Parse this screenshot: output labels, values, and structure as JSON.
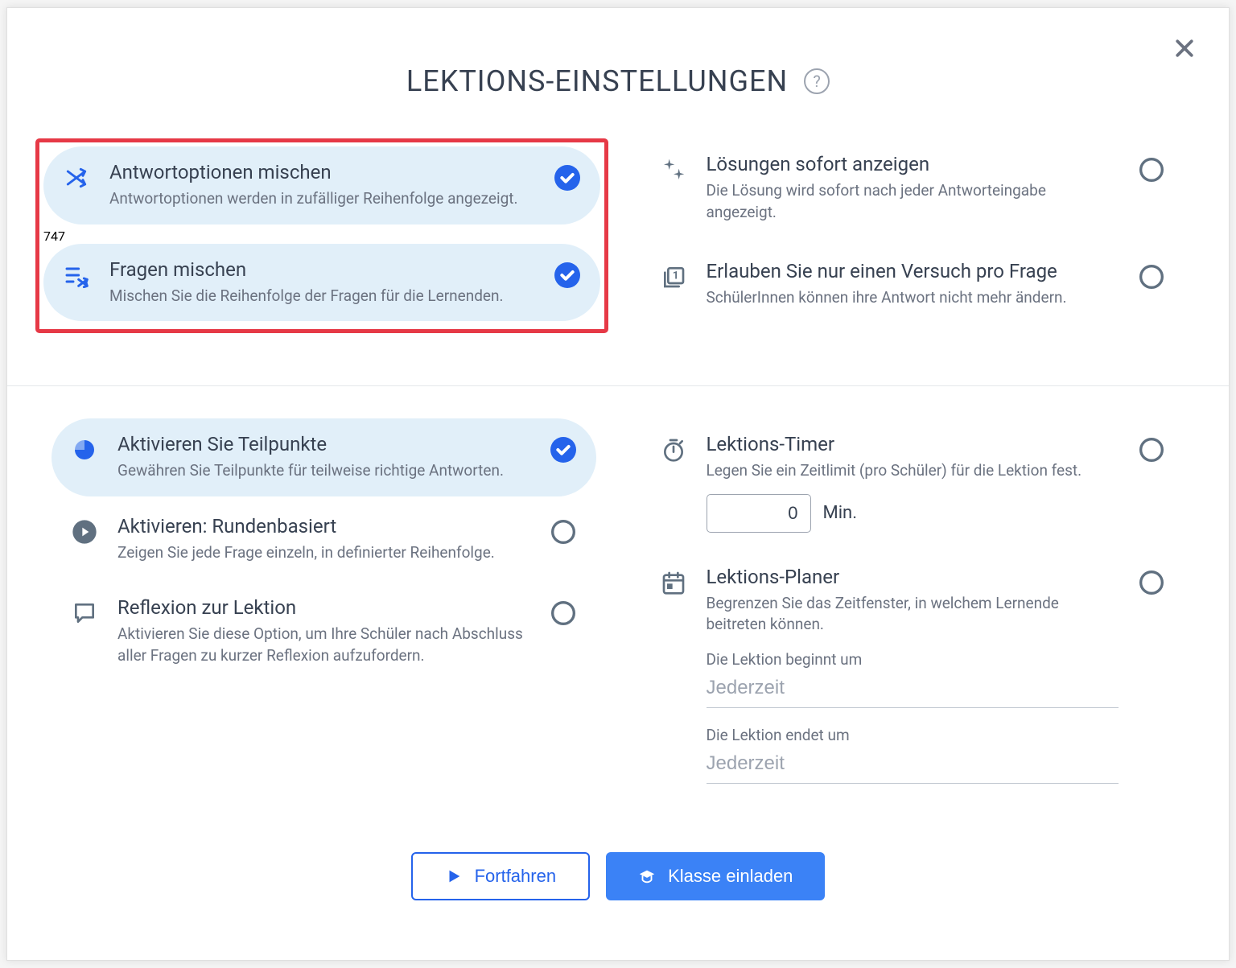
{
  "title": "LEKTIONS-EINSTELLUNGEN",
  "options": {
    "shuffle_answers": {
      "title": "Antwortoptionen mischen",
      "desc": "Antwortoptionen werden in zufälliger Reihenfolge angezeigt.",
      "selected": true
    },
    "shuffle_questions": {
      "title": "Fragen mischen",
      "desc": "Mischen Sie die Reihenfolge der Fragen für die Lernenden.",
      "selected": true
    },
    "show_solutions": {
      "title": "Lösungen sofort anzeigen",
      "desc": "Die Lösung wird sofort nach jeder Antworteingabe angezeigt.",
      "selected": false
    },
    "one_attempt": {
      "title": "Erlauben Sie nur einen Versuch pro Frage",
      "desc": "SchülerInnen können ihre Antwort nicht mehr ändern.",
      "selected": false
    },
    "partial_points": {
      "title": "Aktivieren Sie Teilpunkte",
      "desc": "Gewähren Sie Teilpunkte für teilweise richtige Antworten.",
      "selected": true
    },
    "round_based": {
      "title": "Aktivieren: Rundenbasiert",
      "desc": "Zeigen Sie jede Frage einzeln, in definierter Reihenfolge.",
      "selected": false
    },
    "reflection": {
      "title": "Reflexion zur Lektion",
      "desc": "Aktivieren Sie diese Option, um Ihre Schüler nach Abschluss aller Fragen zu kurzer Reflexion aufzufordern.",
      "selected": false
    },
    "timer": {
      "title": "Lektions-Timer",
      "desc": "Legen Sie ein Zeitlimit (pro Schüler) für die Lektion fest.",
      "selected": false,
      "value": "0",
      "unit": "Min."
    },
    "planner": {
      "title": "Lektions-Planer",
      "desc": "Begrenzen Sie das Zeitfenster, in welchem Lernende beitreten können.",
      "selected": false,
      "start_label": "Die Lektion beginnt um",
      "start_value": "Jederzeit",
      "end_label": "Die Lektion endet um",
      "end_value": "Jederzeit"
    }
  },
  "buttons": {
    "continue": "Fortfahren",
    "invite": "Klasse einladen"
  }
}
